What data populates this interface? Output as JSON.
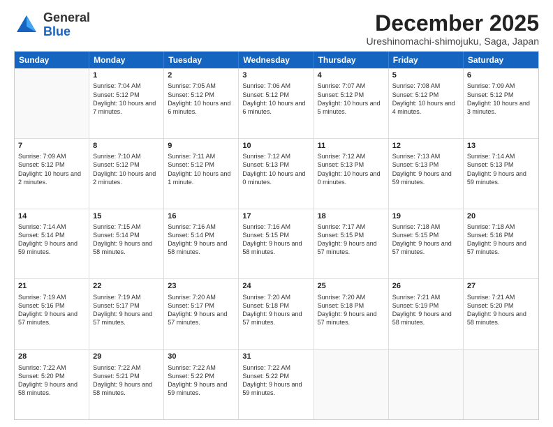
{
  "logo": {
    "general": "General",
    "blue": "Blue"
  },
  "title": "December 2025",
  "location": "Ureshinomachi-shimojuku, Saga, Japan",
  "header_days": [
    "Sunday",
    "Monday",
    "Tuesday",
    "Wednesday",
    "Thursday",
    "Friday",
    "Saturday"
  ],
  "rows": [
    [
      {
        "day": "",
        "info": ""
      },
      {
        "day": "1",
        "info": "Sunrise: 7:04 AM\nSunset: 5:12 PM\nDaylight: 10 hours\nand 7 minutes."
      },
      {
        "day": "2",
        "info": "Sunrise: 7:05 AM\nSunset: 5:12 PM\nDaylight: 10 hours\nand 6 minutes."
      },
      {
        "day": "3",
        "info": "Sunrise: 7:06 AM\nSunset: 5:12 PM\nDaylight: 10 hours\nand 6 minutes."
      },
      {
        "day": "4",
        "info": "Sunrise: 7:07 AM\nSunset: 5:12 PM\nDaylight: 10 hours\nand 5 minutes."
      },
      {
        "day": "5",
        "info": "Sunrise: 7:08 AM\nSunset: 5:12 PM\nDaylight: 10 hours\nand 4 minutes."
      },
      {
        "day": "6",
        "info": "Sunrise: 7:09 AM\nSunset: 5:12 PM\nDaylight: 10 hours\nand 3 minutes."
      }
    ],
    [
      {
        "day": "7",
        "info": "Sunrise: 7:09 AM\nSunset: 5:12 PM\nDaylight: 10 hours\nand 2 minutes."
      },
      {
        "day": "8",
        "info": "Sunrise: 7:10 AM\nSunset: 5:12 PM\nDaylight: 10 hours\nand 2 minutes."
      },
      {
        "day": "9",
        "info": "Sunrise: 7:11 AM\nSunset: 5:12 PM\nDaylight: 10 hours\nand 1 minute."
      },
      {
        "day": "10",
        "info": "Sunrise: 7:12 AM\nSunset: 5:13 PM\nDaylight: 10 hours\nand 0 minutes."
      },
      {
        "day": "11",
        "info": "Sunrise: 7:12 AM\nSunset: 5:13 PM\nDaylight: 10 hours\nand 0 minutes."
      },
      {
        "day": "12",
        "info": "Sunrise: 7:13 AM\nSunset: 5:13 PM\nDaylight: 9 hours\nand 59 minutes."
      },
      {
        "day": "13",
        "info": "Sunrise: 7:14 AM\nSunset: 5:13 PM\nDaylight: 9 hours\nand 59 minutes."
      }
    ],
    [
      {
        "day": "14",
        "info": "Sunrise: 7:14 AM\nSunset: 5:14 PM\nDaylight: 9 hours\nand 59 minutes."
      },
      {
        "day": "15",
        "info": "Sunrise: 7:15 AM\nSunset: 5:14 PM\nDaylight: 9 hours\nand 58 minutes."
      },
      {
        "day": "16",
        "info": "Sunrise: 7:16 AM\nSunset: 5:14 PM\nDaylight: 9 hours\nand 58 minutes."
      },
      {
        "day": "17",
        "info": "Sunrise: 7:16 AM\nSunset: 5:15 PM\nDaylight: 9 hours\nand 58 minutes."
      },
      {
        "day": "18",
        "info": "Sunrise: 7:17 AM\nSunset: 5:15 PM\nDaylight: 9 hours\nand 57 minutes."
      },
      {
        "day": "19",
        "info": "Sunrise: 7:18 AM\nSunset: 5:15 PM\nDaylight: 9 hours\nand 57 minutes."
      },
      {
        "day": "20",
        "info": "Sunrise: 7:18 AM\nSunset: 5:16 PM\nDaylight: 9 hours\nand 57 minutes."
      }
    ],
    [
      {
        "day": "21",
        "info": "Sunrise: 7:19 AM\nSunset: 5:16 PM\nDaylight: 9 hours\nand 57 minutes."
      },
      {
        "day": "22",
        "info": "Sunrise: 7:19 AM\nSunset: 5:17 PM\nDaylight: 9 hours\nand 57 minutes."
      },
      {
        "day": "23",
        "info": "Sunrise: 7:20 AM\nSunset: 5:17 PM\nDaylight: 9 hours\nand 57 minutes."
      },
      {
        "day": "24",
        "info": "Sunrise: 7:20 AM\nSunset: 5:18 PM\nDaylight: 9 hours\nand 57 minutes."
      },
      {
        "day": "25",
        "info": "Sunrise: 7:20 AM\nSunset: 5:18 PM\nDaylight: 9 hours\nand 57 minutes."
      },
      {
        "day": "26",
        "info": "Sunrise: 7:21 AM\nSunset: 5:19 PM\nDaylight: 9 hours\nand 58 minutes."
      },
      {
        "day": "27",
        "info": "Sunrise: 7:21 AM\nSunset: 5:20 PM\nDaylight: 9 hours\nand 58 minutes."
      }
    ],
    [
      {
        "day": "28",
        "info": "Sunrise: 7:22 AM\nSunset: 5:20 PM\nDaylight: 9 hours\nand 58 minutes."
      },
      {
        "day": "29",
        "info": "Sunrise: 7:22 AM\nSunset: 5:21 PM\nDaylight: 9 hours\nand 58 minutes."
      },
      {
        "day": "30",
        "info": "Sunrise: 7:22 AM\nSunset: 5:22 PM\nDaylight: 9 hours\nand 59 minutes."
      },
      {
        "day": "31",
        "info": "Sunrise: 7:22 AM\nSunset: 5:22 PM\nDaylight: 9 hours\nand 59 minutes."
      },
      {
        "day": "",
        "info": ""
      },
      {
        "day": "",
        "info": ""
      },
      {
        "day": "",
        "info": ""
      }
    ]
  ]
}
